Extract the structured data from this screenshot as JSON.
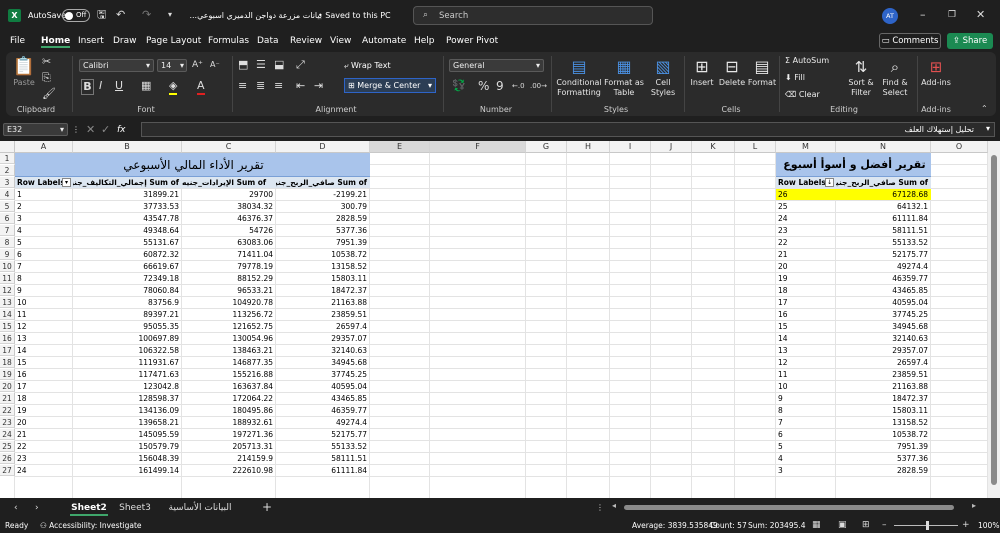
{
  "title": {
    "autosave": "AutoSave",
    "toggle": "Off",
    "doc": "بيانات مزرعة دواجن الدميري اسبوعي...",
    "saved": "• Saved to this PC",
    "search": "Search",
    "avatar": "AT"
  },
  "menu": [
    "File",
    "Home",
    "Insert",
    "Draw",
    "Page Layout",
    "Formulas",
    "Data",
    "Review",
    "View",
    "Automate",
    "Help",
    "Power Pivot"
  ],
  "actions": {
    "comments": "Comments",
    "share": "Share"
  },
  "ribbon": {
    "clipboard": {
      "label": "Clipboard",
      "paste": "Paste"
    },
    "font": {
      "label": "Font",
      "name": "Calibri",
      "size": "14",
      "bold": "B",
      "italic": "I",
      "underline": "U"
    },
    "alignment": {
      "label": "Alignment",
      "wrap": "Wrap Text",
      "merge": "Merge & Center"
    },
    "number": {
      "label": "Number",
      "format": "General",
      "pct": "%",
      "comma": "9"
    },
    "styles": {
      "label": "Styles",
      "cond": "Conditional",
      "cond2": "Formatting",
      "fmt": "Format as",
      "fmt2": "Table",
      "cell": "Cell",
      "cell2": "Styles"
    },
    "cells": {
      "label": "Cells",
      "insert": "Insert",
      "delete": "Delete",
      "format": "Format"
    },
    "editing": {
      "label": "Editing",
      "autosum": "AutoSum",
      "fill": "Fill",
      "clear": "Clear",
      "sort": "Sort &",
      "sort2": "Filter",
      "find": "Find &",
      "find2": "Select"
    },
    "addins": {
      "label": "Add-ins",
      "btn": "Add-ins"
    }
  },
  "formula": {
    "namebox": "E32",
    "fx": "fx",
    "value": "تحليل إستهلاك العلف"
  },
  "columns": [
    "A",
    "B",
    "C",
    "D",
    "E",
    "F",
    "G",
    "H",
    "I",
    "J",
    "K",
    "L",
    "M",
    "N",
    "O"
  ],
  "rows": [
    "1",
    "2",
    "3",
    "4",
    "5",
    "6",
    "7",
    "8",
    "9",
    "10",
    "11",
    "12",
    "13",
    "14",
    "15",
    "16",
    "17",
    "18",
    "19",
    "20",
    "21",
    "22",
    "23",
    "24",
    "25",
    "26",
    "27"
  ],
  "report1": {
    "title": "تقرير الأداء المالي الأسبوعي",
    "h_labels": "Row Labels",
    "h_b": "Sum of إجمالي_التكاليف_جنيه",
    "h_c": "Sum of الإيرادات_جنيه",
    "h_d": "Sum of صافي_الربح_جنيه",
    "data": [
      [
        "1",
        "31899.21",
        "29700",
        "-2199.21"
      ],
      [
        "2",
        "37733.53",
        "38034.32",
        "300.79"
      ],
      [
        "3",
        "43547.78",
        "46376.37",
        "2828.59"
      ],
      [
        "4",
        "49348.64",
        "54726",
        "5377.36"
      ],
      [
        "5",
        "55131.67",
        "63083.06",
        "7951.39"
      ],
      [
        "6",
        "60872.32",
        "71411.04",
        "10538.72"
      ],
      [
        "7",
        "66619.67",
        "79778.19",
        "13158.52"
      ],
      [
        "8",
        "72349.18",
        "88152.29",
        "15803.11"
      ],
      [
        "9",
        "78060.84",
        "96533.21",
        "18472.37"
      ],
      [
        "10",
        "83756.9",
        "104920.78",
        "21163.88"
      ],
      [
        "11",
        "89397.21",
        "113256.72",
        "23859.51"
      ],
      [
        "12",
        "95055.35",
        "121652.75",
        "26597.4"
      ],
      [
        "13",
        "100697.89",
        "130054.96",
        "29357.07"
      ],
      [
        "14",
        "106322.58",
        "138463.21",
        "32140.63"
      ],
      [
        "15",
        "111931.67",
        "146877.35",
        "34945.68"
      ],
      [
        "16",
        "117471.63",
        "155216.88",
        "37745.25"
      ],
      [
        "17",
        "123042.8",
        "163637.84",
        "40595.04"
      ],
      [
        "18",
        "128598.37",
        "172064.22",
        "43465.85"
      ],
      [
        "19",
        "134136.09",
        "180495.86",
        "46359.77"
      ],
      [
        "20",
        "139658.21",
        "188932.61",
        "49274.4"
      ],
      [
        "21",
        "145095.59",
        "197271.36",
        "52175.77"
      ],
      [
        "22",
        "150579.79",
        "205713.31",
        "55133.52"
      ],
      [
        "23",
        "156048.39",
        "214159.9",
        "58111.51"
      ],
      [
        "24",
        "161499.14",
        "222610.98",
        "61111.84"
      ]
    ]
  },
  "report2": {
    "title": "تقرير أفضل و أسوأ أسبوع",
    "h_labels": "Row Labels",
    "h_n": "Sum of صافي_الربح_جنيه",
    "data": [
      [
        "26",
        "67128.68"
      ],
      [
        "25",
        "64132.1"
      ],
      [
        "24",
        "61111.84"
      ],
      [
        "23",
        "58111.51"
      ],
      [
        "22",
        "55133.52"
      ],
      [
        "21",
        "52175.77"
      ],
      [
        "20",
        "49274.4"
      ],
      [
        "19",
        "46359.77"
      ],
      [
        "18",
        "43465.85"
      ],
      [
        "17",
        "40595.04"
      ],
      [
        "16",
        "37745.25"
      ],
      [
        "15",
        "34945.68"
      ],
      [
        "14",
        "32140.63"
      ],
      [
        "13",
        "29357.07"
      ],
      [
        "12",
        "26597.4"
      ],
      [
        "11",
        "23859.51"
      ],
      [
        "10",
        "21163.88"
      ],
      [
        "9",
        "18472.37"
      ],
      [
        "8",
        "15803.11"
      ],
      [
        "7",
        "13158.52"
      ],
      [
        "6",
        "10538.72"
      ],
      [
        "5",
        "7951.39"
      ],
      [
        "4",
        "5377.36"
      ],
      [
        "3",
        "2828.59"
      ]
    ]
  },
  "sheets": [
    "Sheet2",
    "Sheet3",
    "البيانات الأساسية"
  ],
  "status": {
    "ready": "Ready",
    "access": "Accessibility: Investigate",
    "avg": "Average: 3839.535849",
    "count": "Count: 57",
    "sum": "Sum: 203495.4",
    "zoom": "100%"
  },
  "colors": {
    "accent": "#107c41",
    "header_blue": "#a9c4eb",
    "highlight": "#ffff00"
  }
}
